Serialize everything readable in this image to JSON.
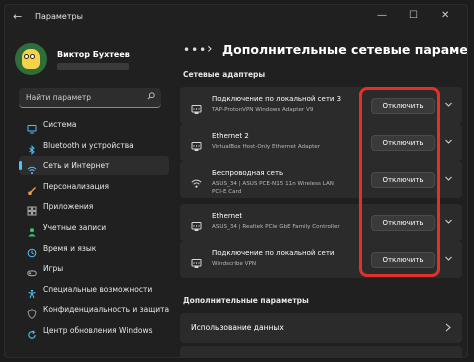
{
  "window": {
    "title": "Параметры",
    "controls": {
      "minimize": "—",
      "maximize": "☐",
      "close": "✕"
    },
    "back": "←"
  },
  "profile": {
    "name": "Виктор Бухтеев"
  },
  "search": {
    "placeholder": "Найти параметр"
  },
  "sidebar": {
    "items": [
      {
        "label": "Система",
        "icon": "monitor-icon",
        "color": "#4cc2ff"
      },
      {
        "label": "Bluetooth и устройства",
        "icon": "bluetooth-icon",
        "color": "#4cc2ff"
      },
      {
        "label": "Сеть и Интернет",
        "icon": "network-icon",
        "color": "#6fb8ff",
        "active": true
      },
      {
        "label": "Персонализация",
        "icon": "brush-icon",
        "color": "#e8a04a"
      },
      {
        "label": "Приложения",
        "icon": "apps-icon",
        "color": "#b0b0b0"
      },
      {
        "label": "Учетные записи",
        "icon": "person-icon",
        "color": "#3fbf6b"
      },
      {
        "label": "Время и язык",
        "icon": "globe-clock-icon",
        "color": "#4cc2ff"
      },
      {
        "label": "Игры",
        "icon": "gamepad-icon",
        "color": "#b0b0b0"
      },
      {
        "label": "Специальные возможности",
        "icon": "accessibility-icon",
        "color": "#4cc2ff"
      },
      {
        "label": "Конфиденциальность и защита",
        "icon": "shield-icon",
        "color": "#9a9a9a"
      },
      {
        "label": "Центр обновления Windows",
        "icon": "update-icon",
        "color": "#4cc2ff"
      }
    ]
  },
  "main": {
    "breadcrumb_dots": "•••",
    "breadcrumb_sep": "›",
    "title": "Дополнительные сетевые параметр",
    "adapters_heading": "Сетевые адаптеры",
    "adapters": [
      {
        "name": "Подключение по локальной сети 3",
        "desc": "TAP-ProtonVPN Windows Adapter V9",
        "icon": "ethernet-icon",
        "button": "Отключить"
      },
      {
        "name": "Ethernet 2",
        "desc": "VirtualBox Host-Only Ethernet Adapter",
        "icon": "ethernet-icon",
        "button": "Отключить"
      },
      {
        "name": "Беспроводная сеть",
        "desc": "ASUS_34 | ASUS PCE-N15 11n Wireless LAN PCI-E Card",
        "icon": "wifi-icon",
        "button": "Отключить"
      },
      {
        "name": "Ethernet",
        "desc": "ASUS_34 | Realtek PCIe GbE Family Controller",
        "icon": "ethernet-icon",
        "button": "Отключить"
      },
      {
        "name": "Подключение по локальной сети",
        "desc": "Windscribe VPN",
        "icon": "ethernet-icon",
        "button": "Отключить"
      }
    ],
    "more_heading": "Дополнительные параметры",
    "data_usage": "Использование данных",
    "highlight_color": "#e0322b"
  }
}
